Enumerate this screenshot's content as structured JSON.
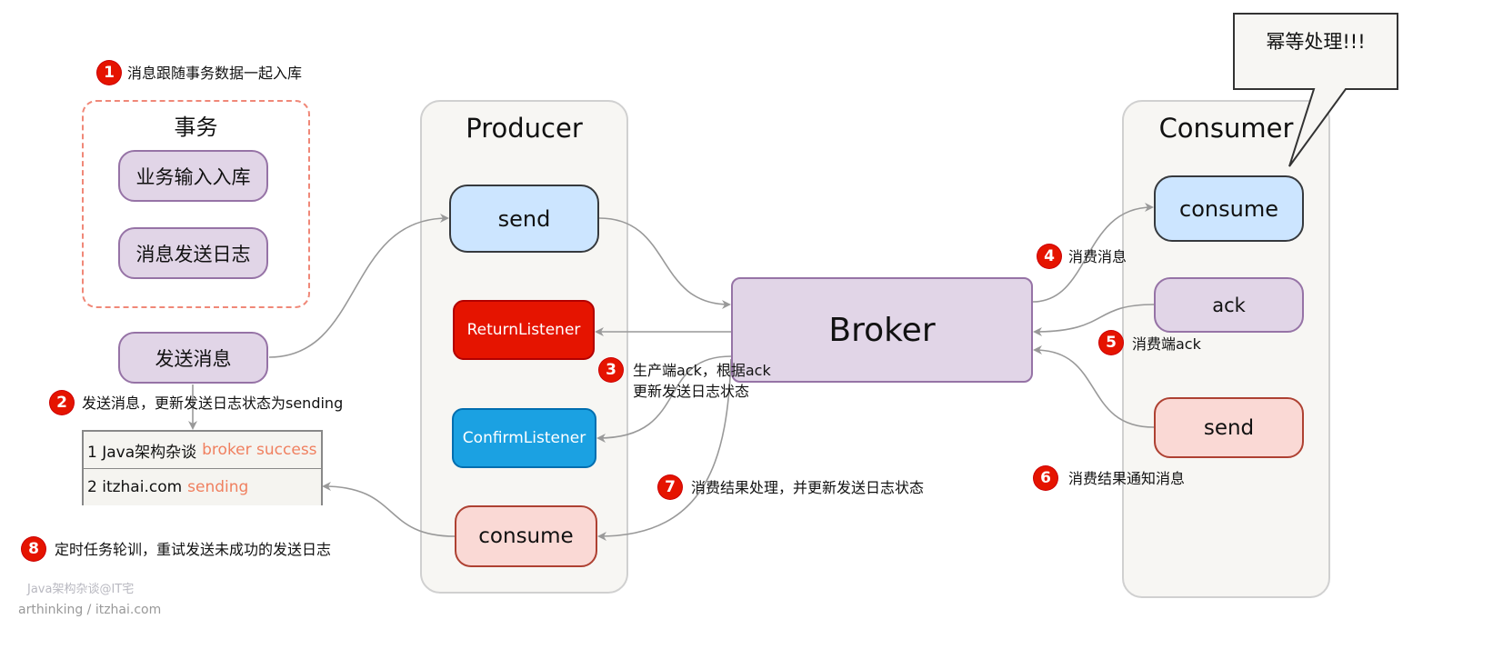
{
  "steps": {
    "s1": {
      "num": "1",
      "text": "消息跟随事务数据一起入库"
    },
    "s2": {
      "num": "2",
      "text": "发送消息，更新发送日志状态为sending"
    },
    "s3": {
      "num": "3",
      "line1": "生产端ack，根据ack",
      "line2": "更新发送日志状态"
    },
    "s4": {
      "num": "4",
      "text": "消费消息"
    },
    "s5": {
      "num": "5",
      "text": "消费端ack"
    },
    "s6": {
      "num": "6",
      "text": "消费结果通知消息"
    },
    "s7": {
      "num": "7",
      "text": "消费结果处理，并更新发送日志状态"
    },
    "s8": {
      "num": "8",
      "text": "定时任务轮训，重试发送未成功的发送日志"
    }
  },
  "transaction": {
    "title": "事务",
    "items": [
      "业务输入入库",
      "消息发送日志"
    ]
  },
  "send_message": "发送消息",
  "log_table": [
    {
      "prefix": "1 Java架构杂谈",
      "status": "broker success"
    },
    {
      "prefix": "2 itzhai.com",
      "status": "sending"
    }
  ],
  "producer": {
    "title": "Producer",
    "send": "send",
    "return_listener": "ReturnListener",
    "confirm_listener": "ConfirmListener",
    "consume": "consume"
  },
  "broker": "Broker",
  "consumer": {
    "title": "Consumer",
    "consume": "consume",
    "ack": "ack",
    "send": "send"
  },
  "callout": "幂等处理!!!",
  "watermark": {
    "line1": "Java架构杂谈@IT宅",
    "line2": "arthinking / itzhai.com"
  },
  "colors": {
    "badge": "#e51400",
    "arrow": "#999999",
    "purple": "#e1d5e7",
    "blue": "#cce5ff",
    "red": "#e51400",
    "cyan": "#1ba1e2",
    "pink": "#fad9d5",
    "accent": "#f08060"
  }
}
